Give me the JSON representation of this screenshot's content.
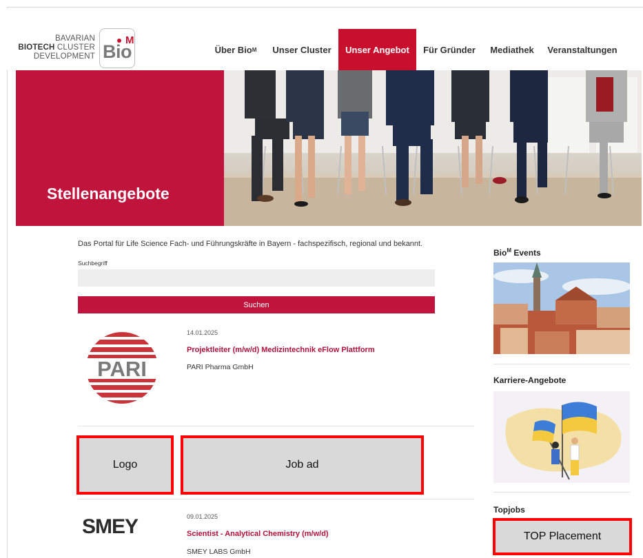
{
  "brand": {
    "line1": "BAVARIAN",
    "line2_bold": "BIOTECH",
    "line2_rest": " CLUSTER",
    "line3": "DEVELOPMENT",
    "mark_main": "Bio",
    "mark_sup": "M"
  },
  "nav": {
    "items": [
      {
        "label": "Über Bio",
        "sup": "M"
      },
      {
        "label": "Unser Cluster"
      },
      {
        "label": "Unser Angebot",
        "active": true
      },
      {
        "label": "Für Gründer"
      },
      {
        "label": "Mediathek"
      },
      {
        "label": "Veranstaltungen"
      }
    ]
  },
  "hero": {
    "title": "Stellenangebote"
  },
  "main": {
    "intro": "Das Portal für Life Science Fach- und Führungskräfte in Bayern - fachspezifisch, regional und bekannt.",
    "search_label": "Suchbegriff",
    "search_value": "",
    "search_button": "Suchen",
    "jobs": [
      {
        "logo_text": "PARI",
        "date": "14.01.2025",
        "title": "Projektleiter (m/w/d) Medizintechnik eFlow Plattform",
        "company": "PARI Pharma GmbH"
      },
      {
        "logo_text": "SMEY",
        "date": "09.01.2025",
        "title": "Scientist - Analytical Chemistry (m/w/d)",
        "company": "SMEY LABS GmbH"
      }
    ],
    "placeholder_logo": "Logo",
    "placeholder_job": "Job ad"
  },
  "sidebar": {
    "events_title": "Bio",
    "events_title_sup": "M",
    "events_title_rest": " Events",
    "careers_title": "Karriere-Angebote",
    "topjobs_title": "Topjobs",
    "top_placement": "TOP Placement"
  },
  "colors": {
    "brand_red": "#c0143c",
    "highlight_border": "#ff0000",
    "placeholder_bg": "#d9d9d9"
  }
}
